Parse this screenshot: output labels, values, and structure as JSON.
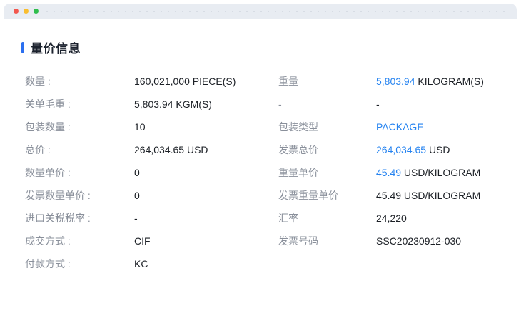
{
  "colors": {
    "accent_blue": "#2583f0",
    "section_bar_blue": "#2b6ff0",
    "titlebar_bg": "#e8ecf2",
    "label_gray": "#8a909b",
    "value_dark": "#1c2026"
  },
  "window": {
    "traffic_lights": [
      {
        "name": "close",
        "color": "#f2574e"
      },
      {
        "name": "minimize",
        "color": "#f9bd2f"
      },
      {
        "name": "maximize",
        "color": "#2ebd4d"
      }
    ]
  },
  "section": {
    "title": "量价信息"
  },
  "rows": [
    {
      "left": {
        "label": "数量 :",
        "value": [
          {
            "text": "160,021,000 PIECE(S)"
          }
        ]
      },
      "right": {
        "label": "重量",
        "value": [
          {
            "text": "5,803.94",
            "accent": true
          },
          {
            "text": " KILOGRAM(S)"
          }
        ]
      }
    },
    {
      "left": {
        "label": "关单毛重 :",
        "value": [
          {
            "text": "5,803.94 KGM(S)"
          }
        ]
      },
      "right": {
        "label": "-",
        "value": [
          {
            "text": "-"
          }
        ]
      }
    },
    {
      "left": {
        "label": "包装数量 :",
        "value": [
          {
            "text": "10"
          }
        ]
      },
      "right": {
        "label": "包装类型",
        "value": [
          {
            "text": "PACKAGE",
            "accent": true
          }
        ]
      }
    },
    {
      "left": {
        "label": "总价 :",
        "value": [
          {
            "text": "264,034.65 USD"
          }
        ]
      },
      "right": {
        "label": "发票总价",
        "value": [
          {
            "text": "264,034.65",
            "accent": true
          },
          {
            "text": " USD"
          }
        ]
      }
    },
    {
      "left": {
        "label": "数量单价 :",
        "value": [
          {
            "text": "0"
          }
        ]
      },
      "right": {
        "label": "重量单价",
        "value": [
          {
            "text": "45.49",
            "accent": true
          },
          {
            "text": " USD/KILOGRAM"
          }
        ]
      }
    },
    {
      "left": {
        "label": "发票数量单价 :",
        "value": [
          {
            "text": "0"
          }
        ]
      },
      "right": {
        "label": "发票重量单价",
        "value": [
          {
            "text": "45.49 USD/KILOGRAM"
          }
        ]
      }
    },
    {
      "left": {
        "label": "进口关税税率 :",
        "value": [
          {
            "text": "-"
          }
        ]
      },
      "right": {
        "label": "汇率",
        "value": [
          {
            "text": "24,220"
          }
        ]
      }
    },
    {
      "left": {
        "label": "成交方式 :",
        "value": [
          {
            "text": "CIF"
          }
        ]
      },
      "right": {
        "label": "发票号码",
        "value": [
          {
            "text": "SSC20230912-030"
          }
        ]
      }
    },
    {
      "left": {
        "label": "付款方式 :",
        "value": [
          {
            "text": "KC"
          }
        ]
      },
      "right": null
    }
  ]
}
